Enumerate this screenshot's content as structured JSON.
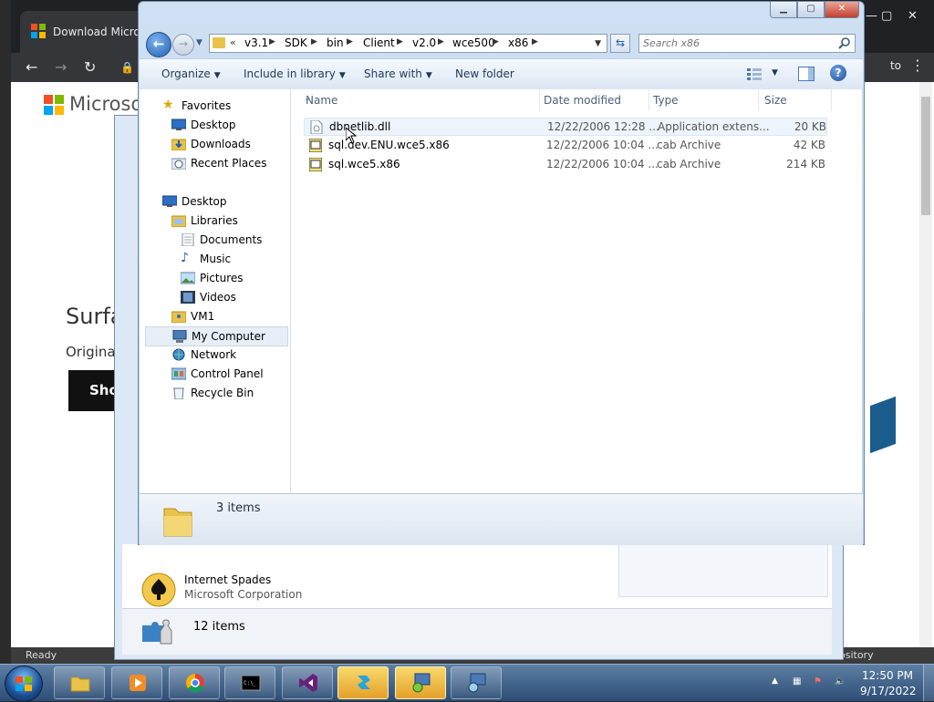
{
  "browser": {
    "tab_title": "Download Micros",
    "account_text": "to",
    "brand_text": "Microsoft",
    "hero_heading": "Surfa",
    "hero_sub": "Original",
    "shop_label": "Sho",
    "status_left": "Ready",
    "status_right": "ository"
  },
  "background_dialog": {
    "item_title": "Internet Spades",
    "item_publisher": "Microsoft Corporation",
    "item_count": "12 items"
  },
  "explorer": {
    "breadcrumb_prefix": "«",
    "breadcrumb": [
      "v3.1",
      "SDK",
      "bin",
      "Client",
      "v2.0",
      "wce500",
      "x86"
    ],
    "search_placeholder": "Search x86",
    "commands": {
      "organize": "Organize",
      "include_library": "Include in library",
      "share_with": "Share with",
      "new_folder": "New folder"
    },
    "nav_pane": {
      "favorites": "Favorites",
      "favorites_items": [
        "Desktop",
        "Downloads",
        "Recent Places"
      ],
      "desktop": "Desktop",
      "libraries": "Libraries",
      "library_items": [
        "Documents",
        "Music",
        "Pictures",
        "Videos"
      ],
      "vm1": "VM1",
      "my_computer": "My Computer",
      "network": "Network",
      "control_panel": "Control Panel",
      "recycle_bin": "Recycle Bin"
    },
    "columns": {
      "name": "Name",
      "date_modified": "Date modified",
      "type": "Type",
      "size": "Size"
    },
    "files": [
      {
        "name": "dbnetlib.dll",
        "date": "12/22/2006 12:28 ...",
        "type": "Application extens...",
        "size": "20 KB"
      },
      {
        "name": "sql.dev.ENU.wce5.x86",
        "date": "12/22/2006 10:04 ...",
        "type": "cab Archive",
        "size": "42 KB"
      },
      {
        "name": "sql.wce5.x86",
        "date": "12/22/2006 10:04 ...",
        "type": "cab Archive",
        "size": "214 KB"
      }
    ],
    "details_count": "3 items"
  },
  "taskbar": {
    "time": "12:50 PM",
    "date": "9/17/2022"
  },
  "colors": {
    "accent_blue": "#1f5fb3",
    "taskbar_active": "#e5a12a",
    "close_red": "#c3412d"
  }
}
